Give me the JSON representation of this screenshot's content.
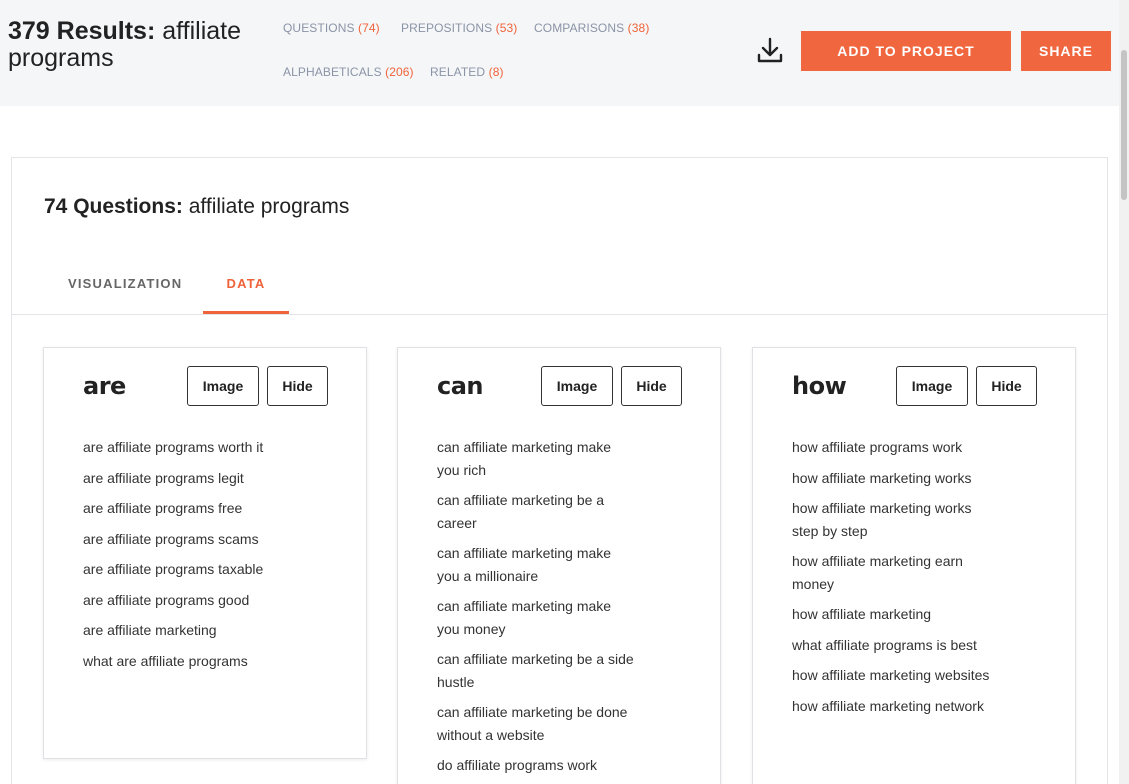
{
  "header": {
    "results_count": "379 Results:",
    "keyword": "affiliate programs",
    "type_links": [
      {
        "label": "QUESTIONS",
        "count": "(74)"
      },
      {
        "label": "PREPOSITIONS",
        "count": "(53)"
      },
      {
        "label": "COMPARISONS",
        "count": "(38)"
      },
      {
        "label": "ALPHABETICALS",
        "count": "(206)"
      },
      {
        "label": "RELATED",
        "count": "(8)"
      }
    ],
    "download_icon": "download-icon",
    "add_to_project_label": "ADD TO PROJECT",
    "share_label": "SHARE",
    "accent_color": "#f0673f"
  },
  "main": {
    "count_label": "74 Questions:",
    "keyword": "affiliate programs",
    "tabs": [
      {
        "label": "VISUALIZATION",
        "active": false
      },
      {
        "label": "DATA",
        "active": true
      }
    ]
  },
  "columns": [
    {
      "heading": "are",
      "image_label": "Image",
      "hide_label": "Hide",
      "items": [
        "are affiliate programs worth it",
        "are affiliate programs legit",
        "are affiliate programs free",
        "are affiliate programs scams",
        "are affiliate programs taxable",
        "are affiliate programs good",
        "are affiliate marketing",
        "what are affiliate programs"
      ]
    },
    {
      "heading": "can",
      "image_label": "Image",
      "hide_label": "Hide",
      "items": [
        "can affiliate marketing make you rich",
        "can affiliate marketing be a career",
        "can affiliate marketing make you a millionaire",
        "can affiliate marketing make you money",
        "can affiliate marketing be a side hustle",
        "can affiliate marketing be done without a website",
        "do affiliate programs work"
      ]
    },
    {
      "heading": "how",
      "image_label": "Image",
      "hide_label": "Hide",
      "items": [
        "how affiliate programs work",
        "how affiliate marketing works",
        "how affiliate marketing works step by step",
        "how affiliate marketing earn money",
        "how affiliate marketing",
        "what affiliate programs is best",
        "how affiliate marketing websites",
        "how affiliate marketing network"
      ]
    }
  ]
}
